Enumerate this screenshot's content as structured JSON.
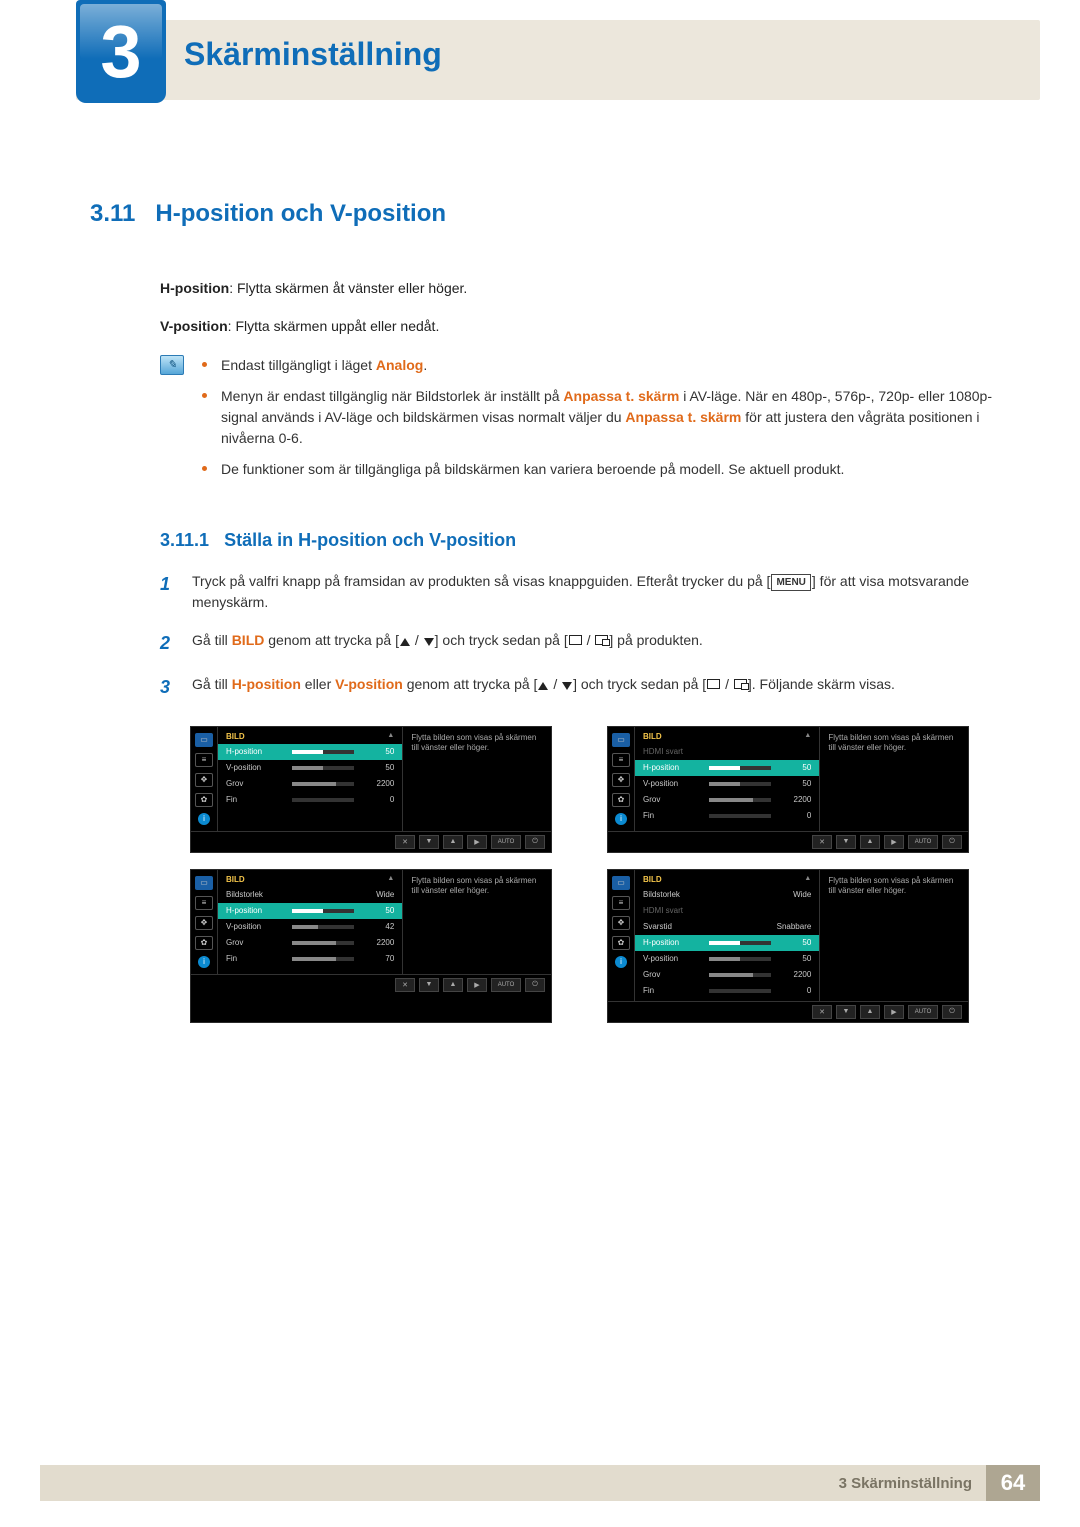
{
  "chapter": {
    "number": "3",
    "title": "Skärminställning"
  },
  "section": {
    "number": "3.11",
    "title": "H-position och V-position"
  },
  "intro": {
    "hpos_label": "H-position",
    "hpos_text": ": Flytta skärmen åt vänster eller höger.",
    "vpos_label": "V-position",
    "vpos_text": ": Flytta skärmen uppåt eller nedåt."
  },
  "notes": {
    "n1_a": "Endast tillgängligt i läget ",
    "n1_b": "Analog",
    "n1_c": ".",
    "n2_a": "Menyn är endast tillgänglig när ",
    "n2_b": "Bildstorlek",
    "n2_c": " är inställt på ",
    "n2_d": "Anpassa t. skärm",
    "n2_e": " i ",
    "n2_f": "AV",
    "n2_g": "-läge. När en 480p-, 576p-, 720p- eller 1080p-signal används i ",
    "n2_h": "AV",
    "n2_i": "-läge och bildskärmen visas normalt väljer du ",
    "n2_j": "Anpassa t. skärm",
    "n2_k": " för att justera den vågräta positionen i nivåerna 0-6.",
    "n3": "De funktioner som är tillgängliga på bildskärmen kan variera beroende på modell. Se aktuell produkt."
  },
  "subsection": {
    "number": "3.11.1",
    "title": "Ställa in H-position och V-position"
  },
  "steps": {
    "s1_a": "Tryck på valfri knapp på framsidan av produkten så visas knappguiden. Efteråt trycker du på [",
    "s1_menu": "MENU",
    "s1_b": "] för att visa motsvarande menyskärm.",
    "s2_a": "Gå till ",
    "s2_bild": "BILD",
    "s2_b": " genom att trycka på [",
    "s2_c": "] och tryck sedan på [",
    "s2_d": "] på produkten.",
    "s3_a": "Gå till ",
    "s3_h": "H-position",
    "s3_or": " eller ",
    "s3_v": "V-position",
    "s3_b": " genom att trycka på [",
    "s3_c": "] och tryck sedan på [",
    "s3_d": "]. Följande skärm visas."
  },
  "osd_common": {
    "title": "BILD",
    "help": "Flytta bilden som visas på skärmen till vänster eller höger.",
    "auto": "AUTO"
  },
  "osd1": {
    "rows": [
      {
        "lbl": "H-position",
        "val": "50",
        "pct": 50,
        "sel": true
      },
      {
        "lbl": "V-position",
        "val": "50",
        "pct": 50
      },
      {
        "lbl": "Grov",
        "val": "2200",
        "pct": 70
      },
      {
        "lbl": "Fin",
        "val": "0",
        "pct": 0
      }
    ]
  },
  "osd2": {
    "rows": [
      {
        "lbl": "HDMI svart",
        "dim": true
      },
      {
        "lbl": "H-position",
        "val": "50",
        "pct": 50,
        "sel": true
      },
      {
        "lbl": "V-position",
        "val": "50",
        "pct": 50
      },
      {
        "lbl": "Grov",
        "val": "2200",
        "pct": 70
      },
      {
        "lbl": "Fin",
        "val": "0",
        "pct": 0
      }
    ]
  },
  "osd3": {
    "rows": [
      {
        "lbl": "Bildstorlek",
        "valtxt": "Wide"
      },
      {
        "lbl": "H-position",
        "val": "50",
        "pct": 50,
        "sel": true
      },
      {
        "lbl": "V-position",
        "val": "42",
        "pct": 42
      },
      {
        "lbl": "Grov",
        "val": "2200",
        "pct": 70
      },
      {
        "lbl": "Fin",
        "val": "70",
        "pct": 70
      }
    ]
  },
  "osd4": {
    "rows": [
      {
        "lbl": "Bildstorlek",
        "valtxt": "Wide"
      },
      {
        "lbl": "HDMI svart",
        "dim": true
      },
      {
        "lbl": "Svarstid",
        "valtxt": "Snabbare"
      },
      {
        "lbl": "H-position",
        "val": "50",
        "pct": 50,
        "sel": true
      },
      {
        "lbl": "V-position",
        "val": "50",
        "pct": 50
      },
      {
        "lbl": "Grov",
        "val": "2200",
        "pct": 70
      },
      {
        "lbl": "Fin",
        "val": "0",
        "pct": 0
      }
    ]
  },
  "footer": {
    "text": "3 Skärminställning",
    "page": "64"
  }
}
